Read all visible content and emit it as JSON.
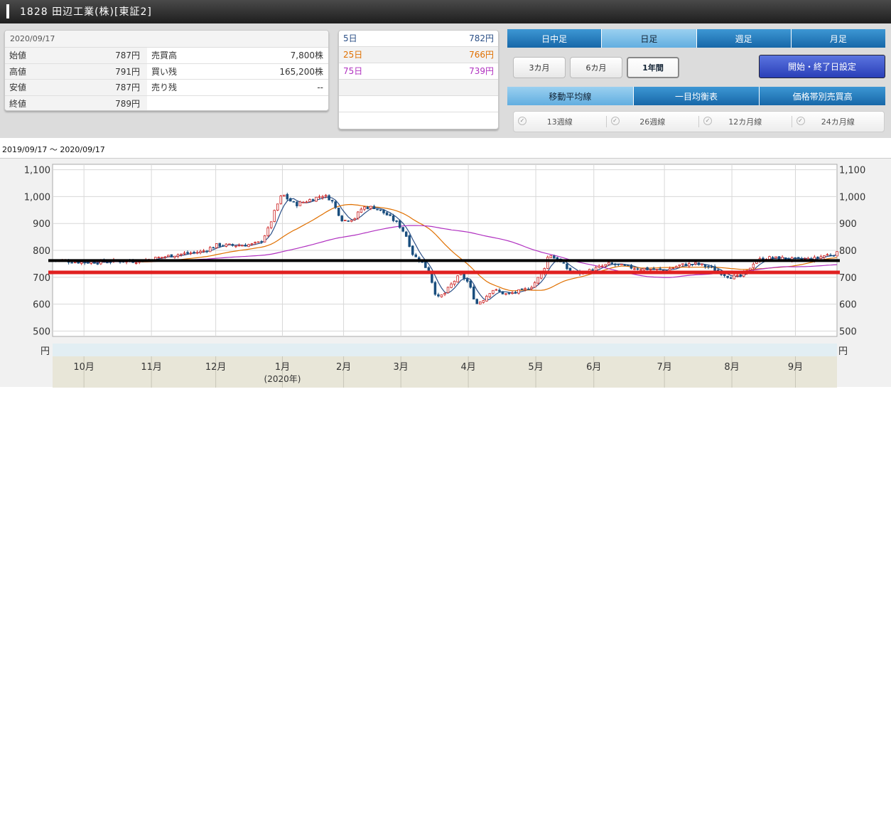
{
  "header": {
    "title": "1828 田辺工業(株)[東証2]"
  },
  "price_box": {
    "date": "2020/09/17",
    "rows": [
      {
        "l1": "始値",
        "v1": "787円",
        "l2": "売買高",
        "v2": "7,800株"
      },
      {
        "l1": "高値",
        "v1": "791円",
        "l2": "買い残",
        "v2": "165,200株"
      },
      {
        "l1": "安値",
        "v1": "787円",
        "l2": "売り残",
        "v2": "--"
      },
      {
        "l1": "終値",
        "v1": "789円",
        "l2": "",
        "v2": ""
      }
    ]
  },
  "ma_box": {
    "rows": [
      {
        "label": "5日",
        "value": "782円",
        "color": "#2b4f86"
      },
      {
        "label": "25日",
        "value": "766円",
        "color": "#e07000"
      },
      {
        "label": "75日",
        "value": "739円",
        "color": "#b030c0"
      }
    ]
  },
  "tabs_type": [
    "日中足",
    "日足",
    "週足",
    "月足"
  ],
  "active_type": "日足",
  "periods": [
    "3カ月",
    "6カ月",
    "1年間"
  ],
  "active_period": "1年間",
  "date_button": "開始・終了日設定",
  "tabs_indicator": [
    "移動平均線",
    "一目均衡表",
    "価格帯別売買高"
  ],
  "active_indicator": "移動平均線",
  "checks": [
    "13週線",
    "26週線",
    "12カ月線",
    "24カ月線"
  ],
  "range_label": "2019/09/17 〜 2020/09/17",
  "chart_data": {
    "type": "candlestick",
    "y_unit": "円",
    "ylim": [
      480,
      1120
    ],
    "yticks": [
      500,
      600,
      700,
      800,
      900,
      1000,
      1100
    ],
    "ytick_labels": [
      "500",
      "600",
      "700",
      "800",
      "900",
      "1,000",
      "1,100"
    ],
    "months": [
      {
        "label": "10月",
        "t": 0.04
      },
      {
        "label": "11月",
        "t": 0.126
      },
      {
        "label": "12月",
        "t": 0.208
      },
      {
        "label": "1月",
        "t": 0.293
      },
      {
        "label": "2月",
        "t": 0.371
      },
      {
        "label": "3月",
        "t": 0.444
      },
      {
        "label": "4月",
        "t": 0.53
      },
      {
        "label": "5月",
        "t": 0.616
      },
      {
        "label": "6月",
        "t": 0.69
      },
      {
        "label": "7月",
        "t": 0.78
      },
      {
        "label": "8月",
        "t": 0.866
      },
      {
        "label": "9月",
        "t": 0.947
      }
    ],
    "year_label": "(2020年)",
    "price_anchors": [
      [
        0,
        765
      ],
      [
        0.04,
        755
      ],
      [
        0.08,
        760
      ],
      [
        0.11,
        760
      ],
      [
        0.14,
        775
      ],
      [
        0.16,
        785
      ],
      [
        0.19,
        795
      ],
      [
        0.21,
        820
      ],
      [
        0.23,
        818
      ],
      [
        0.255,
        822
      ],
      [
        0.265,
        830
      ],
      [
        0.275,
        880
      ],
      [
        0.285,
        960
      ],
      [
        0.293,
        1010
      ],
      [
        0.3,
        990
      ],
      [
        0.31,
        970
      ],
      [
        0.325,
        985
      ],
      [
        0.335,
        995
      ],
      [
        0.345,
        1005
      ],
      [
        0.355,
        990
      ],
      [
        0.362,
        950
      ],
      [
        0.37,
        910
      ],
      [
        0.385,
        920
      ],
      [
        0.395,
        960
      ],
      [
        0.41,
        960
      ],
      [
        0.425,
        935
      ],
      [
        0.44,
        900
      ],
      [
        0.45,
        860
      ],
      [
        0.46,
        780
      ],
      [
        0.47,
        760
      ],
      [
        0.48,
        720
      ],
      [
        0.49,
        620
      ],
      [
        0.5,
        640
      ],
      [
        0.51,
        680
      ],
      [
        0.52,
        710
      ],
      [
        0.53,
        680
      ],
      [
        0.54,
        600
      ],
      [
        0.55,
        620
      ],
      [
        0.56,
        655
      ],
      [
        0.57,
        645
      ],
      [
        0.58,
        635
      ],
      [
        0.59,
        645
      ],
      [
        0.6,
        650
      ],
      [
        0.612,
        670
      ],
      [
        0.625,
        720
      ],
      [
        0.633,
        790
      ],
      [
        0.64,
        770
      ],
      [
        0.65,
        750
      ],
      [
        0.66,
        720
      ],
      [
        0.67,
        715
      ],
      [
        0.68,
        720
      ],
      [
        0.69,
        730
      ],
      [
        0.71,
        750
      ],
      [
        0.72,
        745
      ],
      [
        0.74,
        735
      ],
      [
        0.76,
        730
      ],
      [
        0.78,
        725
      ],
      [
        0.8,
        745
      ],
      [
        0.82,
        750
      ],
      [
        0.84,
        735
      ],
      [
        0.86,
        705
      ],
      [
        0.875,
        700
      ],
      [
        0.885,
        720
      ],
      [
        0.895,
        760
      ],
      [
        0.91,
        772
      ],
      [
        0.93,
        770
      ],
      [
        0.95,
        765
      ],
      [
        0.97,
        768
      ],
      [
        0.985,
        782
      ],
      [
        1.0,
        789
      ]
    ],
    "series": [
      {
        "name": "5日",
        "color": "#2b4f86"
      },
      {
        "name": "25日",
        "color": "#e07000"
      },
      {
        "name": "75日",
        "color": "#b030c0"
      }
    ],
    "hlines": [
      {
        "y": 762,
        "color": "#000000"
      },
      {
        "y": 718,
        "color": "#e02020"
      }
    ],
    "up_color": "#cc2020",
    "down_color": "#1a4e7e"
  }
}
